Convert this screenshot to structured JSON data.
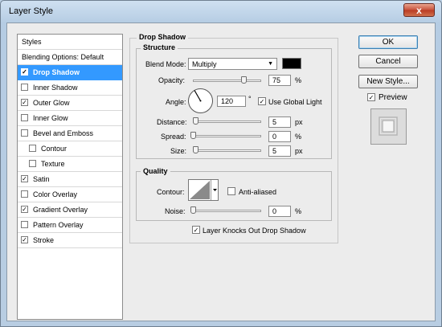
{
  "window": {
    "title": "Layer Style",
    "close_glyph": "x"
  },
  "styles": [
    {
      "label": "Styles",
      "kind": "header"
    },
    {
      "label": "Blending Options: Default",
      "kind": "header"
    },
    {
      "label": "Drop Shadow",
      "checked": true,
      "highlighted": true,
      "indent": 0
    },
    {
      "label": "Inner Shadow",
      "checked": false,
      "indent": 0
    },
    {
      "label": "Outer Glow",
      "checked": true,
      "indent": 0
    },
    {
      "label": "Inner Glow",
      "checked": false,
      "indent": 0
    },
    {
      "label": "Bevel and Emboss",
      "checked": false,
      "indent": 0
    },
    {
      "label": "Contour",
      "checked": false,
      "indent": 1
    },
    {
      "label": "Texture",
      "checked": false,
      "indent": 1
    },
    {
      "label": "Satin",
      "checked": true,
      "indent": 0
    },
    {
      "label": "Color Overlay",
      "checked": false,
      "indent": 0
    },
    {
      "label": "Gradient Overlay",
      "checked": true,
      "indent": 0
    },
    {
      "label": "Pattern Overlay",
      "checked": false,
      "indent": 0
    },
    {
      "label": "Stroke",
      "checked": true,
      "indent": 0
    }
  ],
  "drop_shadow": {
    "title": "Drop Shadow",
    "structure": {
      "title": "Structure",
      "blend_mode_label": "Blend Mode:",
      "blend_mode_value": "Multiply",
      "blend_color": "#000000",
      "opacity_label": "Opacity:",
      "opacity_value": "75",
      "opacity_level": 75,
      "opacity_unit": "%",
      "angle_label": "Angle:",
      "angle_value": "120",
      "angle_unit": "°",
      "use_global_light_label": "Use Global Light",
      "use_global_light": true,
      "distance_label": "Distance:",
      "distance_value": "5",
      "distance_unit": "px",
      "spread_label": "Spread:",
      "spread_value": "0",
      "spread_unit": "%",
      "size_label": "Size:",
      "size_value": "5",
      "size_unit": "px"
    },
    "quality": {
      "title": "Quality",
      "contour_label": "Contour:",
      "anti_aliased_label": "Anti-aliased",
      "anti_aliased": false,
      "noise_label": "Noise:",
      "noise_value": "0",
      "noise_unit": "%"
    },
    "knocks_out_label": "Layer Knocks Out Drop Shadow",
    "knocks_out": true
  },
  "buttons": {
    "ok": "OK",
    "cancel": "Cancel",
    "new_style": "New Style...",
    "preview_label": "Preview",
    "preview_checked": true
  },
  "check_glyph": "✓",
  "dropdown_arrow_glyph": "▼"
}
